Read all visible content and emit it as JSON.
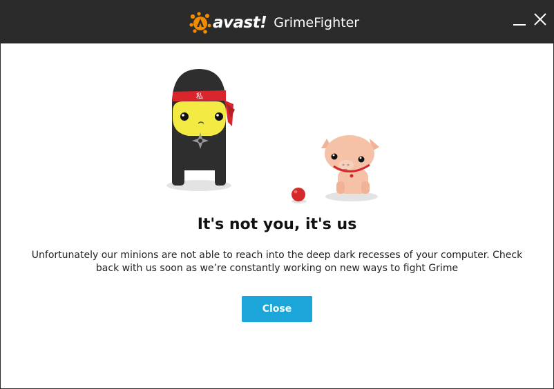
{
  "titlebar": {
    "brand_wordmark": "avast!",
    "product_name": "GrimeFighter",
    "logo_icon": "avast-orange-splat-logo",
    "minimize_icon": "minimize-icon",
    "close_icon": "close-icon"
  },
  "content": {
    "headline": "It's not you, it's us",
    "message": "Unfortunately our minions are not able to reach into the deep dark recesses of your computer. Check back with us soon as we’re constantly working on new ways to fight Grime",
    "close_button_label": "Close"
  },
  "illustration": {
    "ninja_headband_glyph": "私",
    "characters": [
      "ninja-character",
      "pig-character",
      "red-ball"
    ]
  },
  "colors": {
    "titlebar_bg": "#2b2b2b",
    "brand_orange": "#f28b00",
    "accent_button": "#1ba5d8",
    "headband_red": "#d8262c",
    "ninja_face_yellow": "#f3ea44",
    "pig_pink": "#f5c1a7",
    "ball_red": "#d42a2a"
  }
}
